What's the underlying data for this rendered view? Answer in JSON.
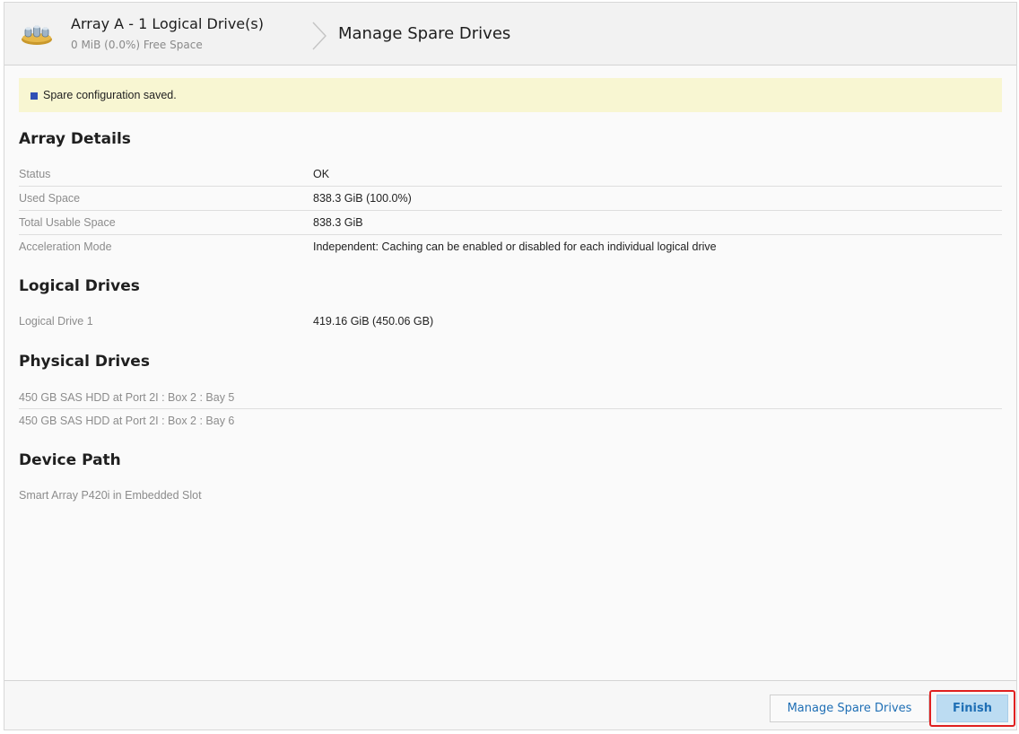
{
  "header": {
    "array_title": "Array A - 1 Logical Drive(s)",
    "array_subtitle": "0 MiB (0.0%) Free Space",
    "page_title": "Manage Spare Drives"
  },
  "notice": {
    "text": "Spare configuration saved."
  },
  "array_details": {
    "heading": "Array Details",
    "rows": [
      {
        "label": "Status",
        "value": "OK"
      },
      {
        "label": "Used Space",
        "value": "838.3 GiB (100.0%)"
      },
      {
        "label": "Total Usable Space",
        "value": "838.3 GiB"
      },
      {
        "label": "Acceleration Mode",
        "value": "Independent: Caching can be enabled or disabled for each individual logical drive"
      }
    ]
  },
  "logical_drives": {
    "heading": "Logical Drives",
    "rows": [
      {
        "label": "Logical Drive 1",
        "value": "419.16 GiB (450.06 GB)"
      }
    ]
  },
  "physical_drives": {
    "heading": "Physical Drives",
    "items": [
      "450 GB SAS HDD at Port 2I : Box 2 : Bay 5",
      "450 GB SAS HDD at Port 2I : Box 2 : Bay 6"
    ]
  },
  "device_path": {
    "heading": "Device Path",
    "value": "Smart Array P420i in Embedded Slot"
  },
  "footer": {
    "manage_label": "Manage Spare Drives",
    "finish_label": "Finish"
  },
  "colors": {
    "accent": "#1f6fb5",
    "notice_bg": "#f8f6d2",
    "notice_icon": "#2f4fb5",
    "finish_bg": "#bcdcf2",
    "highlight": "#e02020"
  },
  "icons": {
    "array": "disk-array-icon",
    "separator": "chevron-right-icon",
    "notice": "info-square-icon"
  }
}
